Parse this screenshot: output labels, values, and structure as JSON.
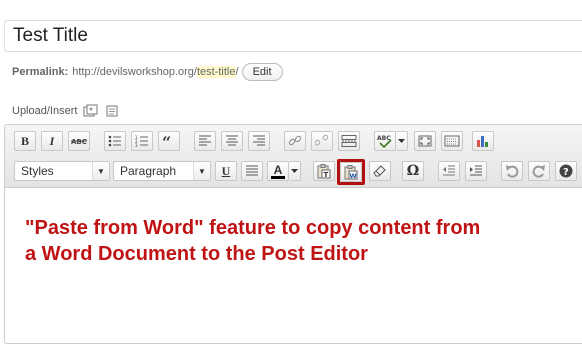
{
  "post": {
    "title": "Test Title"
  },
  "permalink": {
    "label": "Permalink:",
    "base_url": "http://devilsworkshop.org/",
    "slug": "test-title",
    "trailing_slash": "/",
    "edit_label": "Edit"
  },
  "upload": {
    "label": "Upload/Insert",
    "icons": [
      "add-image-icon",
      "add-media-icon"
    ]
  },
  "toolbar": {
    "row1": [
      "bold-icon",
      "italic-icon",
      "strikethrough-icon",
      "bullet-list-icon",
      "numbered-list-icon",
      "blockquote-icon",
      "align-left-icon",
      "align-center-icon",
      "align-right-icon",
      "insert-link-icon",
      "unlink-icon",
      "insert-more-tag-icon",
      "spellcheck-icon",
      "spellcheck-dropdown-icon",
      "fullscreen-icon",
      "kitchen-sink-icon",
      "chart-icon"
    ],
    "bold_label": "B",
    "italic_label": "I",
    "styles_select": "Styles",
    "format_select": "Paragraph",
    "underline_label": "U",
    "text_color_label": "A",
    "omega_label": "Ω",
    "row2": [
      "paste-as-text-icon",
      "paste-from-word-icon",
      "clear-formatting-icon",
      "special-character-icon",
      "outdent-icon",
      "indent-icon",
      "undo-icon",
      "redo-icon",
      "help-icon"
    ],
    "highlighted": "paste-from-word-icon"
  },
  "annotation": {
    "text": "\"Paste from Word\" feature to copy content from a Word Document to the Post Editor",
    "color": "#c01414"
  }
}
